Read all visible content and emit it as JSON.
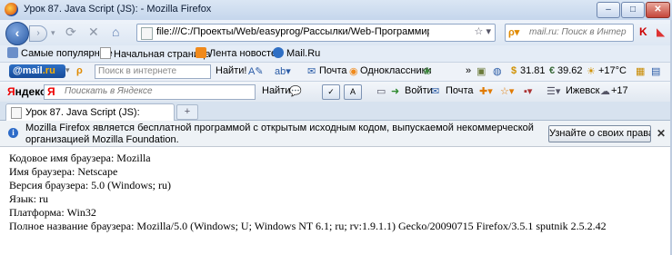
{
  "window": {
    "title": "Урок 87. Java Script (JS): - Mozilla Firefox",
    "minimize": "–",
    "maximize": "□",
    "close": "✕"
  },
  "nav": {
    "back": "‹",
    "forward": "›",
    "stop": "✕",
    "home": "⌂",
    "url": "file:///C:/Проекты/Web/easyprog/Рассылки/Web-Программирование/прим",
    "url_tail": "☆ ▾",
    "search_engine": "ρ▾",
    "search_placeholder": "mail.ru: Поиск в Интер",
    "addon": "K"
  },
  "bookmarks": [
    {
      "label": "Самые популярные",
      "icon": "star-icon"
    },
    {
      "label": "Начальная страница",
      "icon": "page-icon"
    },
    {
      "label": "Лента новостей",
      "icon": "rss-icon"
    },
    {
      "label": "Mail.Ru",
      "icon": "mailru-icon"
    }
  ],
  "mailru_bar": {
    "logo_main": "@mail",
    "logo_suffix": ".ru",
    "search_placeholder": "Поиск в интернете",
    "find": "Найти!",
    "mail": "Почта",
    "ok": "Одноклассники",
    "currency_usd": "31.81",
    "currency_eur": "39.62",
    "weather": "+17°C"
  },
  "yandex_bar": {
    "logo": "Яндекс",
    "search_placeholder": "Поискать в Яндексе",
    "find": "Найти",
    "login": "Войти",
    "mail": "Почта",
    "city": "Ижевск",
    "temp": "+17"
  },
  "tab": {
    "label": "Урок 87. Java Script (JS):",
    "new": "+"
  },
  "notification": {
    "info": "i",
    "message": "Mozilla Firefox является бесплатной программой с открытым исходным кодом, выпускаемой некоммерческой организацией Mozilla Foundation.",
    "button": "Узнайте о своих правах...",
    "close": "✕"
  },
  "content": {
    "lines": [
      "Кодовое имя браузера: Mozilla",
      "Имя браузера: Netscape",
      "Версия браузера: 5.0 (Windows; ru)",
      "Язык: ru",
      "Платформа: Win32",
      "Полное название браузера: Mozilla/5.0 (Windows; U; Windows NT 6.1; ru; rv:1.9.1.1) Gecko/20090715 Firefox/3.5.1 sputnik 2.5.2.42"
    ]
  }
}
